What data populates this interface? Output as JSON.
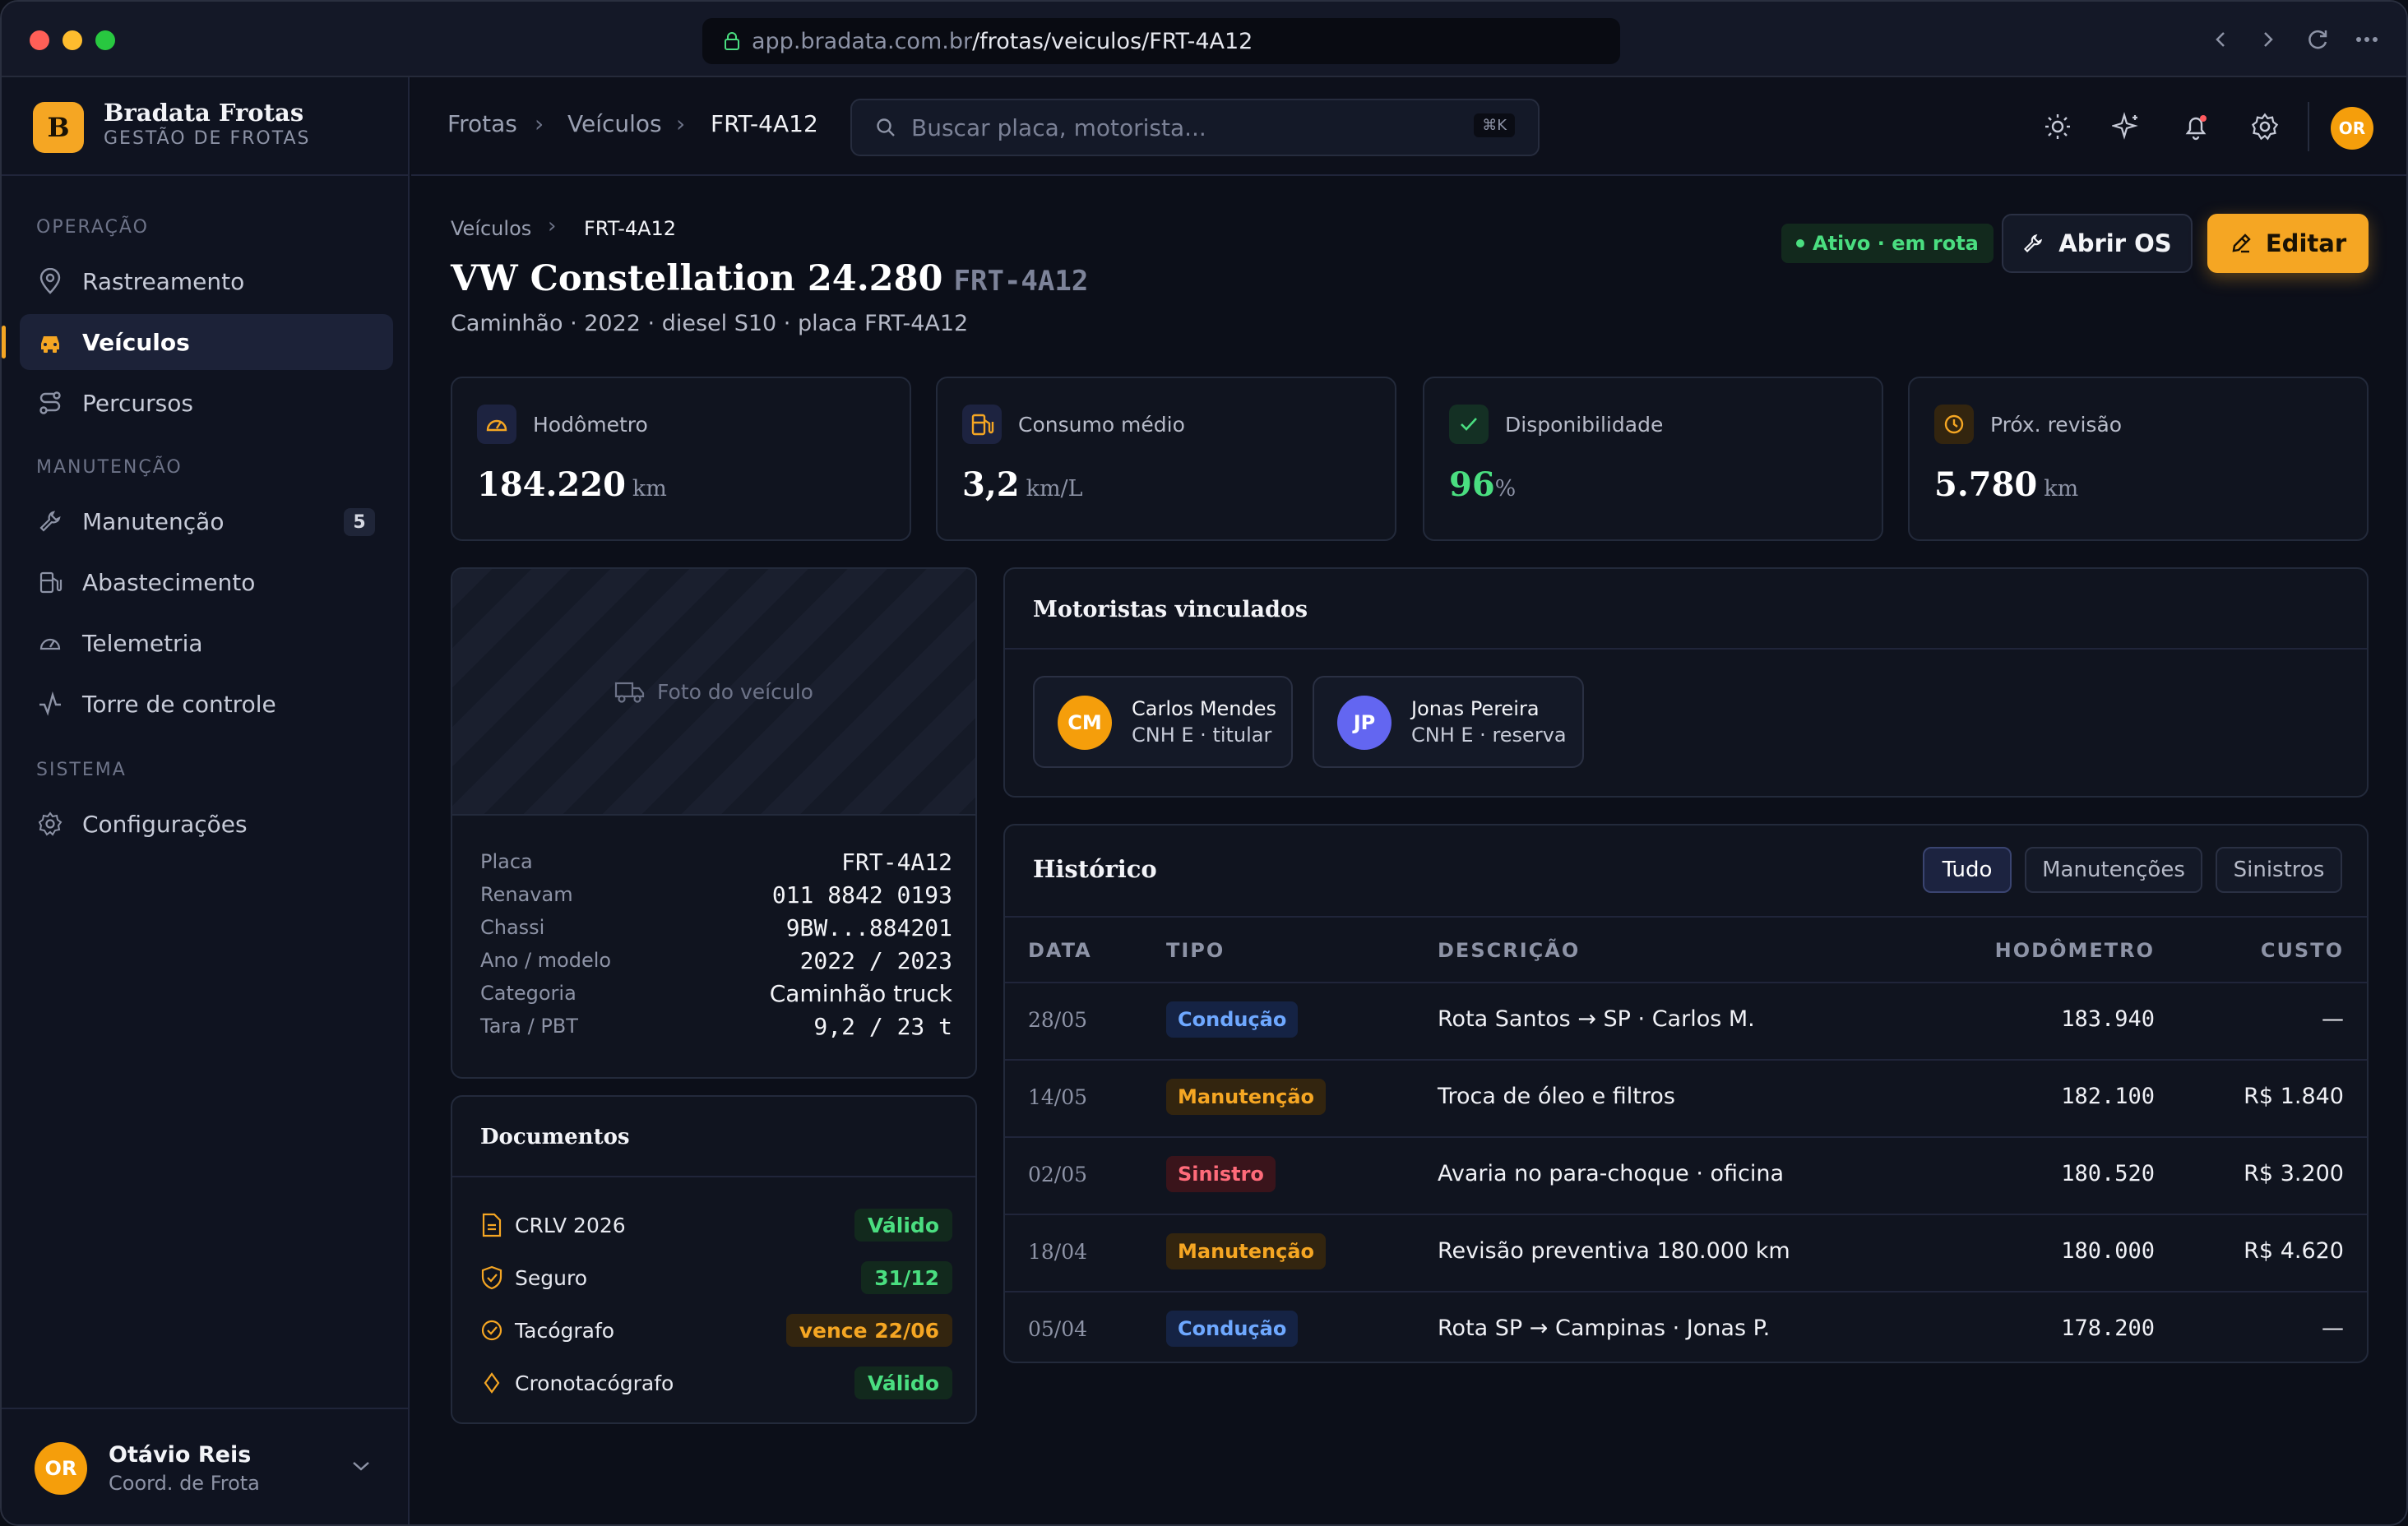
{
  "browser": {
    "url_host": "app.bradata.com.br",
    "url_path": "/frotas/veiculos/FRT-4A12"
  },
  "brand": {
    "initial": "B",
    "name": "Bradata Frotas",
    "subtitle": "GESTÃO DE FROTAS"
  },
  "sidebar": {
    "sections": [
      {
        "title": "OPERAÇÃO"
      },
      {
        "title": "MANUTENÇÃO"
      },
      {
        "title": "SISTEMA"
      }
    ],
    "items": [
      {
        "label": "Rastreamento",
        "icon": "pin-icon"
      },
      {
        "label": "Veículos",
        "icon": "car-icon",
        "active": true
      },
      {
        "label": "Percursos",
        "icon": "route-icon"
      },
      {
        "label": "Manutenção",
        "icon": "wrench-icon",
        "badge": "5"
      },
      {
        "label": "Abastecimento",
        "icon": "fuel-icon"
      },
      {
        "label": "Telemetria",
        "icon": "gauge-icon"
      },
      {
        "label": "Torre de controle",
        "icon": "activity-icon"
      },
      {
        "label": "Configurações",
        "icon": "gear-icon"
      }
    ]
  },
  "user": {
    "initials": "OR",
    "name": "Otávio Reis",
    "role": "Coord. de Frota"
  },
  "topbar": {
    "breadcrumb": [
      "Frotas",
      "Veículos",
      "FRT-4A12"
    ],
    "search_placeholder": "Buscar placa, motorista...",
    "search_shortcut": "⌘K",
    "avatar_initials": "OR"
  },
  "page": {
    "breadcrumb": [
      "Veículos",
      "FRT-4A12"
    ],
    "title": "VW Constellation 24.280",
    "plate": "FRT-4A12",
    "subtitle": "Caminhão · 2022 · diesel S10 · placa FRT-4A12",
    "status": "Ativo · em rota",
    "open_os_label": "Abrir OS",
    "edit_label": "Editar"
  },
  "stats": [
    {
      "label": "Hodômetro",
      "value": "184.220",
      "unit": "km",
      "icon": "gauge-icon"
    },
    {
      "label": "Consumo médio",
      "value": "3,2",
      "unit": "km/L",
      "icon": "fuel-icon"
    },
    {
      "label": "Disponibilidade",
      "value": "96",
      "unit": "%",
      "icon": "check-icon"
    },
    {
      "label": "Próx. revisão",
      "value": "5.780",
      "unit": "km",
      "icon": "clock-icon"
    }
  ],
  "photo": {
    "label": "Foto do veículo"
  },
  "specs": [
    {
      "key": "Placa",
      "value": "FRT-4A12"
    },
    {
      "key": "Renavam",
      "value": "011 8842 0193"
    },
    {
      "key": "Chassi",
      "value": "9BW...884201"
    },
    {
      "key": "Ano / modelo",
      "value": "2022 / 2023"
    },
    {
      "key": "Categoria",
      "value": "Caminhão truck"
    },
    {
      "key": "Tara / PBT",
      "value": "9,2 / 23 t"
    }
  ],
  "documents": {
    "title": "Documentos",
    "items": [
      {
        "name": "CRLV 2026",
        "status": "Válido",
        "icon": "file-icon"
      },
      {
        "name": "Seguro",
        "status": "31/12",
        "icon": "shield-icon"
      },
      {
        "name": "Tacógrafo",
        "status": "vence 22/06",
        "icon": "badge-check-icon"
      },
      {
        "name": "Cronotacógrafo",
        "status": "Válido",
        "icon": "diamond-icon"
      }
    ]
  },
  "drivers": {
    "title": "Motoristas vinculados",
    "items": [
      {
        "initials": "CM",
        "name": "Carlos Mendes",
        "license": "CNH E · titular",
        "color": "#f59e0b"
      },
      {
        "initials": "JP",
        "name": "Jonas Pereira",
        "license": "CNH E · reserva",
        "color": "#6366f1"
      }
    ]
  },
  "history": {
    "title": "Histórico",
    "tabs": [
      "Tudo",
      "Manutenções",
      "Sinistros"
    ],
    "columns": [
      "DATA",
      "TIPO",
      "DESCRIÇÃO",
      "HODÔMETRO",
      "CUSTO"
    ],
    "rows": [
      {
        "date": "28/05",
        "type": "Condução",
        "desc": "Rota Santos → SP · Carlos M.",
        "odo": "183.940",
        "cost": "—"
      },
      {
        "date": "14/05",
        "type": "Manutenção",
        "desc": "Troca de óleo e filtros",
        "odo": "182.100",
        "cost": "R$ 1.840"
      },
      {
        "date": "02/05",
        "type": "Sinistro",
        "desc": "Avaria no para-choque · oficina",
        "odo": "180.520",
        "cost": "R$ 3.200"
      },
      {
        "date": "18/04",
        "type": "Manutenção",
        "desc": "Revisão preventiva 180.000 km",
        "odo": "180.000",
        "cost": "R$ 4.620"
      },
      {
        "date": "05/04",
        "type": "Condução",
        "desc": "Rota SP → Campinas · Jonas P.",
        "odo": "178.200",
        "cost": "—"
      }
    ]
  },
  "colors": {
    "accent": "#f5a623",
    "success": "#4ade80",
    "danger": "#ff6b7a",
    "info": "#6ea8ff"
  }
}
